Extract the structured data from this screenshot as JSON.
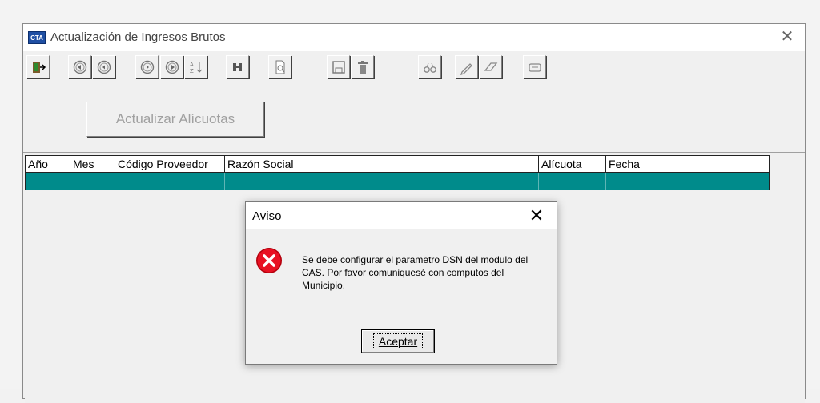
{
  "window": {
    "title": "Actualización de Ingresos Brutos",
    "app_icon_text": "CTA",
    "close_glyph": "✕"
  },
  "toolbar": {
    "icons": [
      "exit-icon",
      "first-record-icon",
      "previous-record-icon",
      "next-record-icon",
      "last-record-icon",
      "sort-icon",
      "find-icon",
      "preview-icon",
      "save-icon",
      "delete-icon",
      "view-icon",
      "edit-icon",
      "erase-icon",
      "keyboard-icon"
    ]
  },
  "actions": {
    "actualizar_label": "Actualizar Alícuotas"
  },
  "grid": {
    "columns": [
      "Año",
      "Mes",
      "Código Proveedor",
      "Razón Social",
      "Alícuota",
      "Fecha"
    ],
    "selected_row_color": "#008b8b"
  },
  "dialog": {
    "title": "Aviso",
    "close_glyph": "✕",
    "message": "Se debe configurar el parametro DSN del modulo del CAS. Por favor comuniquesé con computos del Municipio.",
    "ok_label": "Aceptar",
    "icon": "error-icon",
    "error_color": "#e81123"
  }
}
